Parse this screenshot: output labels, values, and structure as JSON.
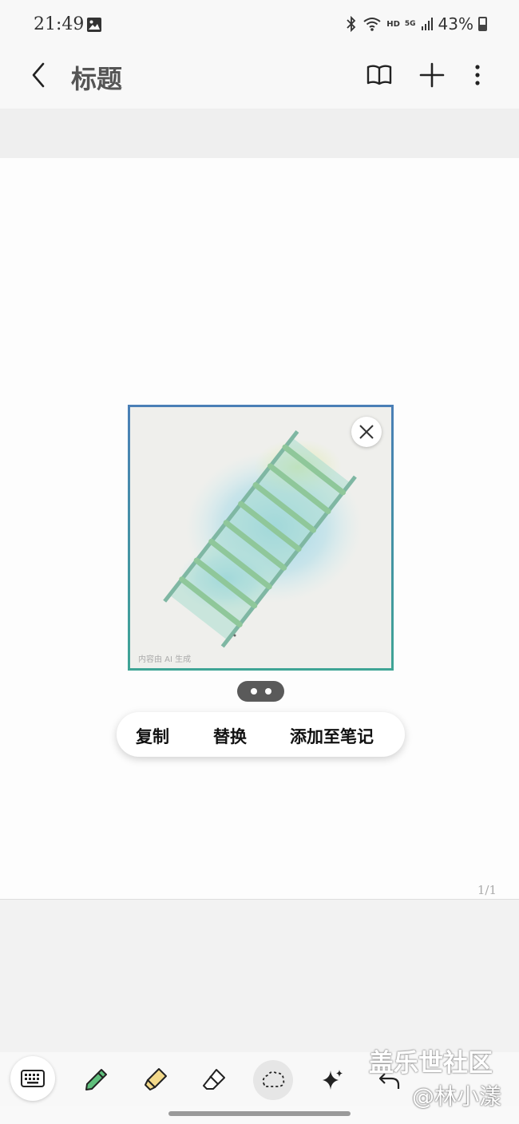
{
  "status_bar": {
    "time": "21:49",
    "hd": "HD",
    "network": "5G",
    "battery": "43%"
  },
  "app_bar": {
    "title": "标题"
  },
  "image": {
    "watermark": "内容由 AI 生成"
  },
  "context_menu": {
    "copy": "复制",
    "replace": "替换",
    "add_to_note": "添加至笔记"
  },
  "page_indicator": "1/1",
  "watermark": {
    "line1": "盖乐世社区",
    "line2": "@林小漾"
  },
  "icons": [
    "gallery-icon",
    "bluetooth-icon",
    "wifi-icon",
    "signal-icon",
    "battery-icon",
    "back-icon",
    "book-icon",
    "plus-icon",
    "more-icon",
    "close-icon",
    "keyboard-icon",
    "pen-icon",
    "highlighter-icon",
    "eraser-icon",
    "lasso-icon",
    "sparkle-icon",
    "undo-icon"
  ]
}
